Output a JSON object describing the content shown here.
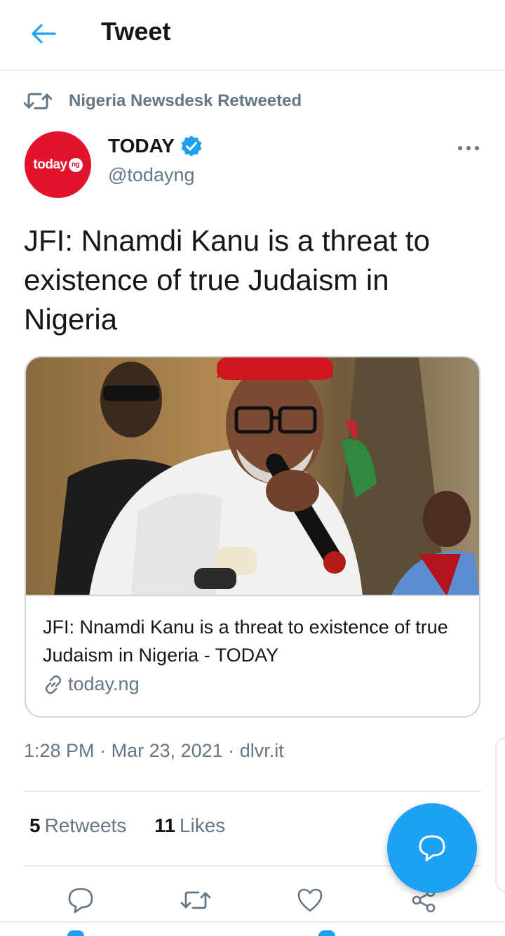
{
  "header": {
    "title": "Tweet"
  },
  "retweet_context": {
    "text": "Nigeria Newsdesk Retweeted"
  },
  "author": {
    "display_name": "TODAY",
    "handle": "@todayng",
    "avatar_text": "today",
    "avatar_badge": "ng",
    "verified": true
  },
  "tweet": {
    "text": "JFI: Nnamdi Kanu is a threat to existence of true Judaism in Nigeria"
  },
  "card": {
    "title": "JFI: Nnamdi Kanu is a threat to existence of true Judaism in Nigeria - TODAY",
    "domain": "today.ng"
  },
  "meta": {
    "time": "1:28 PM",
    "date": "Mar 23, 2021",
    "source": "dlvr.it",
    "separator": "·"
  },
  "stats": {
    "retweets_count": "5",
    "retweets_label": "Retweets",
    "likes_count": "11",
    "likes_label": "Likes"
  },
  "colors": {
    "accent": "#1da1f2",
    "text_primary": "#14171a",
    "text_secondary": "#657786",
    "divider": "#e6ecf0",
    "avatar_bg": "#e3132b",
    "verified": "#1da1f2"
  },
  "icons": {
    "back": "arrow-left-icon",
    "retweet_context": "retweet-icon",
    "verified": "verified-badge-icon",
    "more": "more-icon",
    "link": "link-icon",
    "reply": "reply-icon",
    "retweet": "retweet-icon",
    "like": "heart-icon",
    "share": "share-icon",
    "compose": "compose-reply-icon"
  }
}
